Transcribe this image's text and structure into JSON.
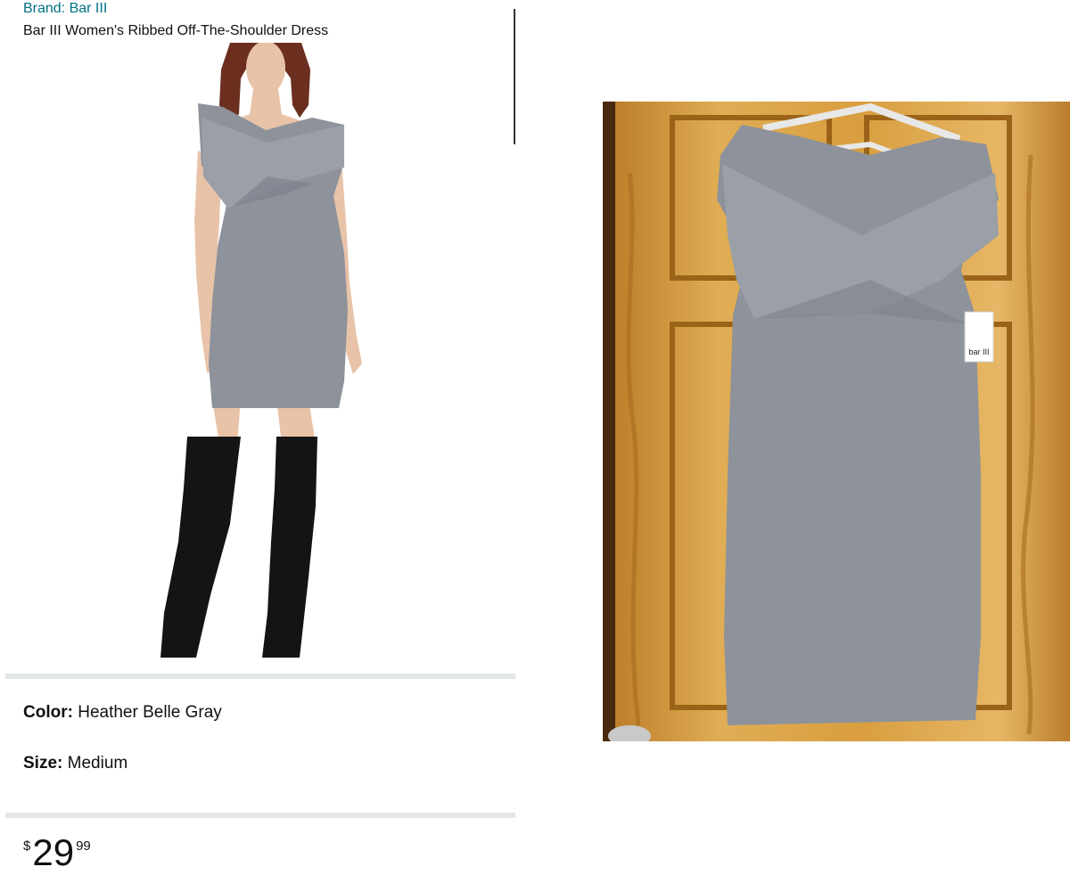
{
  "listing": {
    "brand_link": "Brand: Bar III",
    "title": "Bar III Women's Ribbed Off-The-Shoulder Dress"
  },
  "attributes": {
    "color_label": "Color:",
    "color_value": "Heather Belle Gray",
    "size_label": "Size:",
    "size_value": "Medium"
  },
  "price": {
    "symbol": "$",
    "whole": "29",
    "fraction": "99"
  },
  "photo": {
    "tag_text": "bar III"
  },
  "colors": {
    "link": "#007185",
    "dress": "#8d929b",
    "door": "#d9a446",
    "boots": "#141414",
    "divider": "#e3e6e6"
  }
}
